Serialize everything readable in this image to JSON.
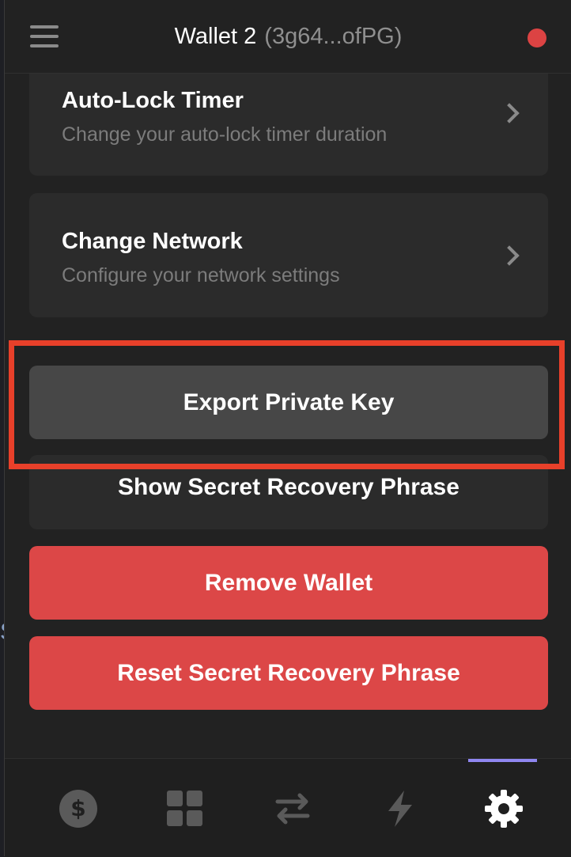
{
  "header": {
    "wallet_name": "Wallet 2",
    "wallet_address": "(3g64...ofPG)",
    "menu_icon": "hamburger-menu-icon",
    "status_color": "#dc4343"
  },
  "settings": {
    "auto_lock": {
      "title": "Auto-Lock Timer",
      "description": "Change your auto-lock timer duration"
    },
    "network": {
      "title": "Change Network",
      "description": "Configure your network settings"
    }
  },
  "actions": {
    "export_private_key": "Export Private Key",
    "show_recovery_phrase": "Show Secret Recovery Phrase",
    "remove_wallet": "Remove Wallet",
    "reset_recovery_phrase": "Reset Secret Recovery Phrase"
  },
  "tabs": [
    {
      "icon": "dollar-coin-icon",
      "active": false
    },
    {
      "icon": "grid-apps-icon",
      "active": false
    },
    {
      "icon": "swap-arrows-icon",
      "active": false
    },
    {
      "icon": "lightning-bolt-icon",
      "active": false
    },
    {
      "icon": "gear-icon",
      "active": true
    }
  ],
  "colors": {
    "accent": "#8f86f0",
    "danger": "#dc4747",
    "highlight": "#e8402a"
  }
}
